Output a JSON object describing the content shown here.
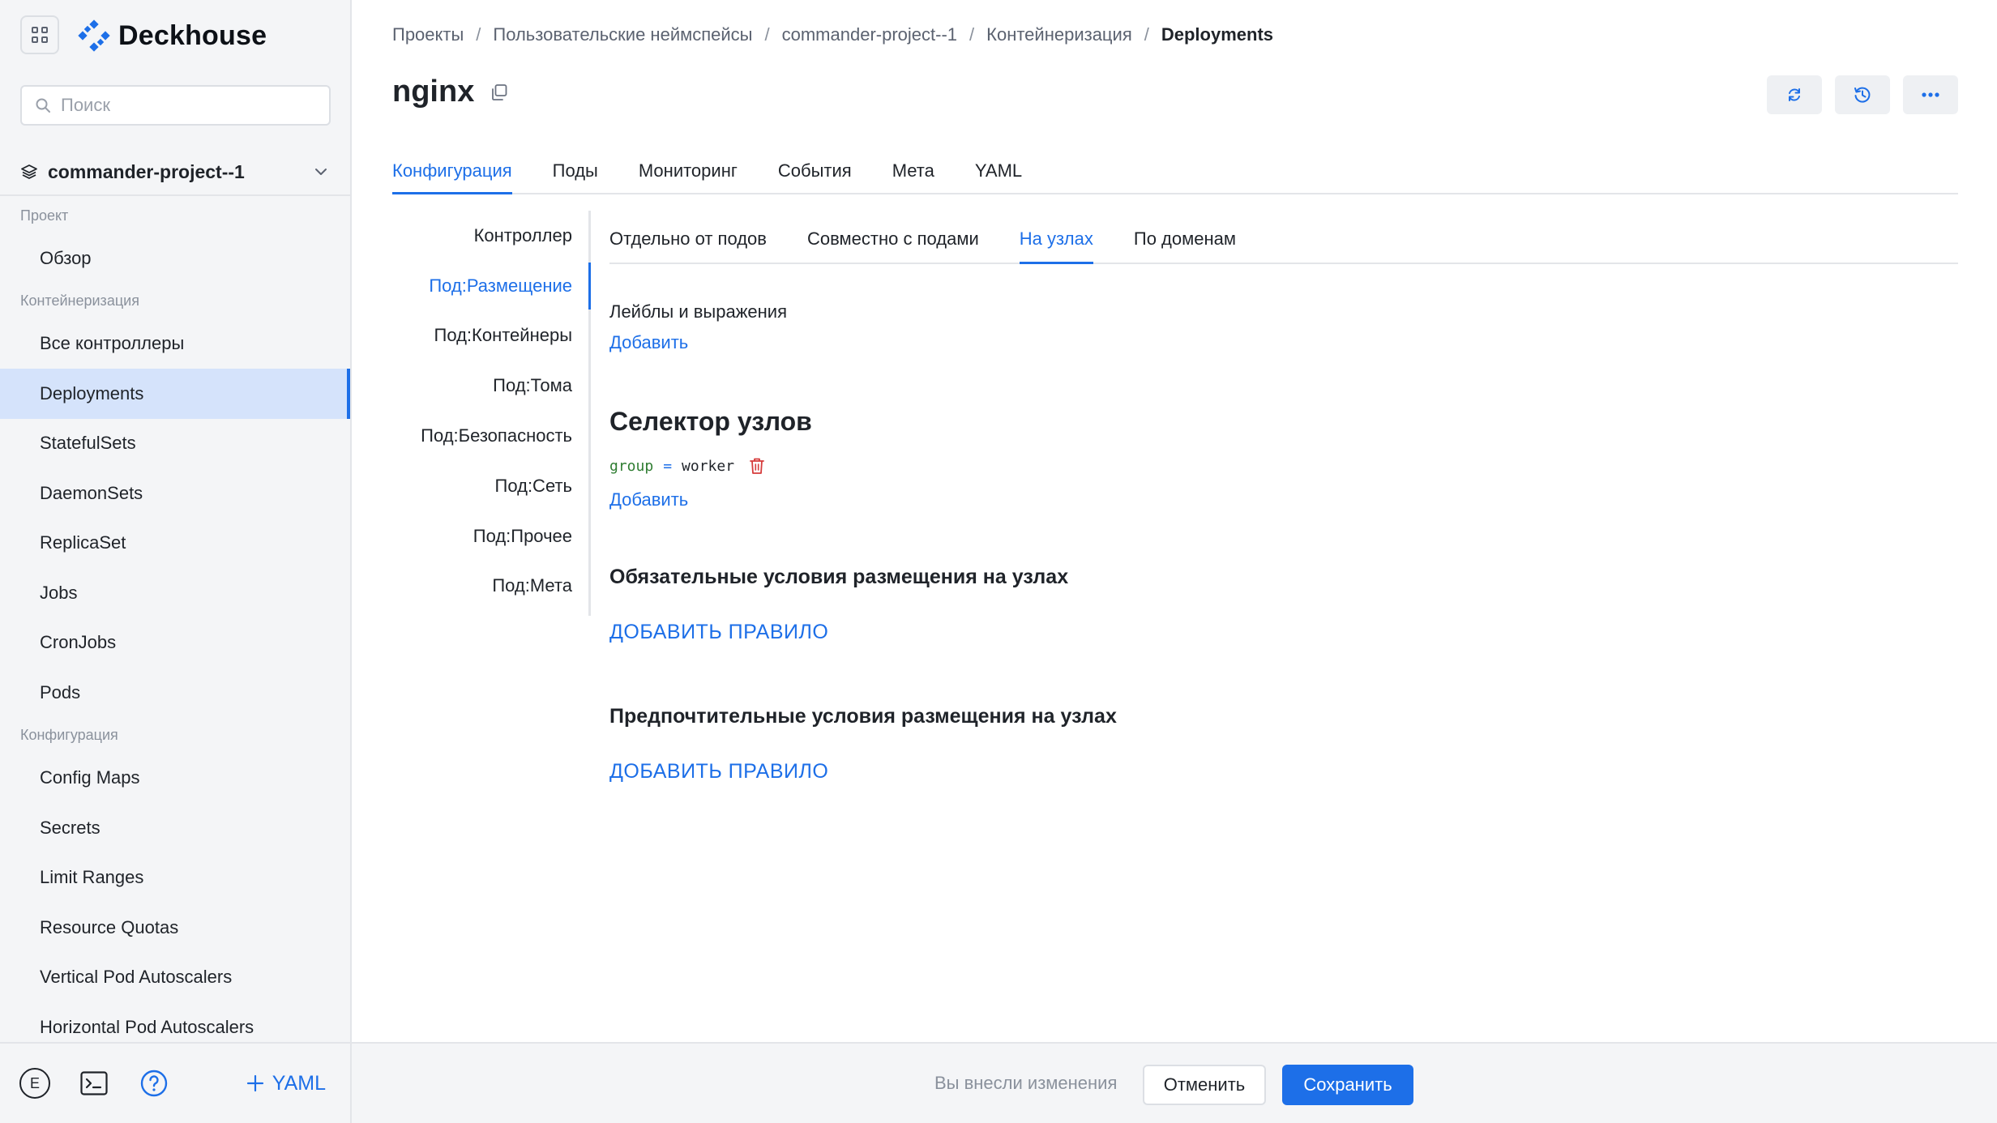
{
  "app": {
    "brand": "Deckhouse",
    "brand_color": "#1d6fe8"
  },
  "sidebar": {
    "search_placeholder": "Поиск",
    "project": "commander-project--1",
    "sections": [
      {
        "title": "Проект",
        "items": [
          {
            "label": "Обзор"
          }
        ]
      },
      {
        "title": "Контейнеризация",
        "items": [
          {
            "label": "Все контроллеры"
          },
          {
            "label": "Deployments",
            "active": true
          },
          {
            "label": "StatefulSets"
          },
          {
            "label": "DaemonSets"
          },
          {
            "label": "ReplicaSet"
          },
          {
            "label": "Jobs"
          },
          {
            "label": "CronJobs"
          },
          {
            "label": "Pods"
          }
        ]
      },
      {
        "title": "Конфигурация",
        "items": [
          {
            "label": "Config Maps"
          },
          {
            "label": "Secrets"
          },
          {
            "label": "Limit Ranges"
          },
          {
            "label": "Resource Quotas"
          },
          {
            "label": "Vertical Pod Autoscalers"
          },
          {
            "label": "Horizontal Pod Autoscalers"
          }
        ]
      }
    ],
    "footer": {
      "avatar_letter": "E",
      "yaml_button": "YAML"
    }
  },
  "breadcrumb": {
    "items": [
      "Проекты",
      "Пользовательские неймспейсы",
      "commander-project--1",
      "Контейнеризация"
    ],
    "separator": "/",
    "current": "Deployments"
  },
  "page": {
    "title": "nginx"
  },
  "tabs": [
    "Конфигурация",
    "Поды",
    "Мониторинг",
    "События",
    "Мета",
    "YAML"
  ],
  "active_tab": "Конфигурация",
  "config_nav": [
    "Контроллер",
    "Под:Размещение",
    "Под:Контейнеры",
    "Под:Тома",
    "Под:Безопасность",
    "Под:Сеть",
    "Под:Прочее",
    "Под:Мета"
  ],
  "active_config_nav": "Под:Размещение",
  "subtabs": [
    "Отдельно от подов",
    "Совместно с подами",
    "На узлах",
    "По доменам"
  ],
  "active_subtab": "На узлах",
  "placement": {
    "labels_title": "Лейблы и выражения",
    "add_link": "Добавить",
    "node_selector_title": "Селектор узлов",
    "selector": {
      "key": "group",
      "operator": "=",
      "value": "worker"
    },
    "add_link_2": "Добавить",
    "required_title": "Обязательные условия размещения на узлах",
    "add_rule": "ДОБАВИТЬ ПРАВИЛО",
    "preferred_title": "Предпочтительные условия размещения на узлах",
    "add_rule_2": "ДОБАВИТЬ ПРАВИЛО"
  },
  "bottom_bar": {
    "changes_text": "Вы внесли изменения",
    "cancel": "Отменить",
    "save": "Сохранить",
    "save_color": "#1d6fe8"
  }
}
